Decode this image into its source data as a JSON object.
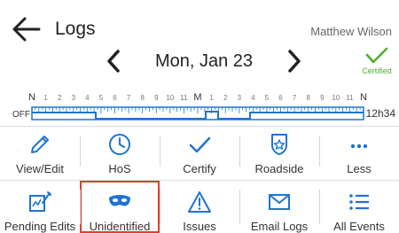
{
  "header": {
    "title": "Logs",
    "user_name": "Matthew Wilson",
    "date": "Mon, Jan 23",
    "certified_label": "Certified",
    "accent_color": "#1f74d0",
    "certified_color": "#4caf2b"
  },
  "log_grid": {
    "hour_labels": [
      "N",
      "1",
      "2",
      "3",
      "4",
      "5",
      "6",
      "7",
      "8",
      "9",
      "10",
      "11",
      "M",
      "1",
      "2",
      "3",
      "4",
      "5",
      "6",
      "7",
      "8",
      "9",
      "10",
      "11",
      "N"
    ],
    "status_label": "OFF",
    "total": "12h34"
  },
  "actions_row1": [
    {
      "label": "View/Edit",
      "icon": "pencil-icon"
    },
    {
      "label": "HoS",
      "icon": "clock-icon"
    },
    {
      "label": "Certify",
      "icon": "checkmark-icon"
    },
    {
      "label": "Roadside",
      "icon": "badge-icon"
    },
    {
      "label": "Less",
      "icon": "more-icon"
    }
  ],
  "actions_row2": [
    {
      "label": "Pending Edits",
      "icon": "edit-chart-icon"
    },
    {
      "label": "Unidentified",
      "icon": "mask-icon"
    },
    {
      "label": "Issues",
      "icon": "warning-icon"
    },
    {
      "label": "Email Logs",
      "icon": "envelope-icon"
    },
    {
      "label": "All Events",
      "icon": "list-icon"
    }
  ],
  "selected_action": "Unidentified",
  "selected_outline_color": "#e53b30"
}
